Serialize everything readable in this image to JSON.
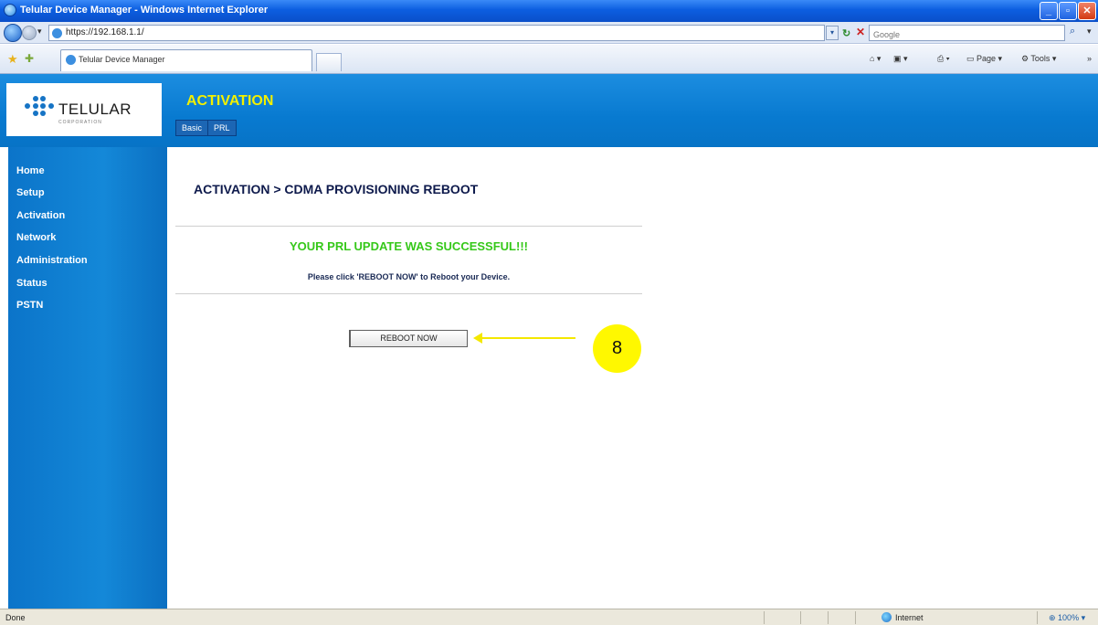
{
  "window": {
    "title": "Telular Device Manager - Windows Internet Explorer"
  },
  "address_bar": {
    "url": "https://192.168.1.1/",
    "search_placeholder": "Google"
  },
  "tab": {
    "label": "Telular Device Manager"
  },
  "command_bar": {
    "page": "Page",
    "tools": "Tools"
  },
  "header": {
    "logo_text": "TELULAR",
    "logo_sub": "CORPORATION",
    "section_title": "ACTIVATION",
    "subtabs": [
      "Basic",
      "PRL"
    ]
  },
  "sidebar": {
    "items": [
      "Home",
      "Setup",
      "Activation",
      "Network",
      "Administration",
      "Status",
      "PSTN"
    ]
  },
  "main": {
    "title": "ACTIVATION > CDMA PROVISIONING REBOOT",
    "success_message": "YOUR PRL UPDATE WAS SUCCESSFUL!!!",
    "instruction": "Please click 'REBOOT NOW' to Reboot your Device.",
    "reboot_button": "REBOOT NOW"
  },
  "annotation": {
    "step_number": "8",
    "color": "#fff800"
  },
  "status_bar": {
    "status": "Done",
    "zone": "Internet",
    "zoom": "100%"
  },
  "colors": {
    "header_blue": "#087ad0",
    "section_title_yellow": "#f2f000",
    "success_green": "#36c81a",
    "title_navy": "#0e1a4c"
  }
}
